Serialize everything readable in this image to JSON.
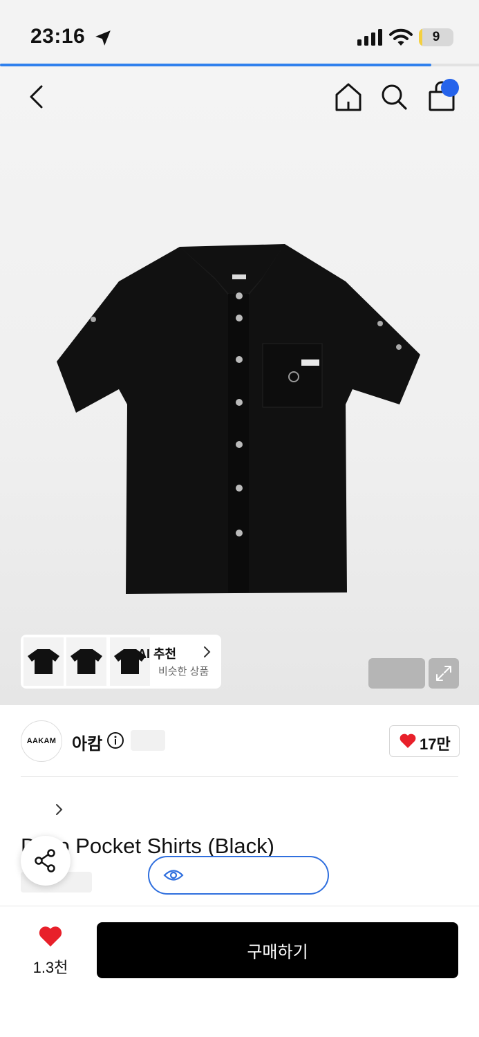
{
  "status_bar": {
    "time": "23:16",
    "battery": "9",
    "battery_level": 0.09,
    "icons": [
      "location-arrow-icon",
      "signal-icon",
      "wifi-icon",
      "battery-icon"
    ]
  },
  "page_load_progress": 0.9,
  "nav": {
    "icons": [
      "back-arrow-icon",
      "home-icon",
      "search-icon",
      "shopping-bag-icon"
    ],
    "cart_indicator_color": "#2563eb"
  },
  "ai_recommend": {
    "title": "AI 추천",
    "subtitle": "비슷한 상품"
  },
  "brand": {
    "logo_text": "AAKAM",
    "name": "아캄",
    "likes": "17만"
  },
  "product": {
    "title": "D   Up Pocket Shirts (Black)"
  },
  "bottom_bar": {
    "likes": "1.3천",
    "buy_label": "구매하기"
  },
  "colors": {
    "accent_blue": "#2f80ed",
    "heart_red": "#e8202a",
    "buy_button": "#000000"
  }
}
